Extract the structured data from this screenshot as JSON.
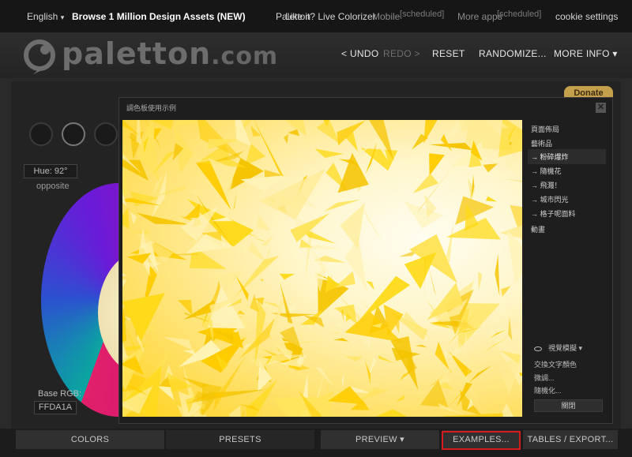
{
  "topbar": {
    "language": "English",
    "language_arrow": "▾",
    "promo": "Browse 1 Million Design Assets (NEW)",
    "paletton_label": "Paletton",
    "like_label": "Like it? Live Colorizer",
    "mobile_label": "Mobile",
    "mobile_status": "[scheduled]",
    "more_apps_label": "More apps",
    "more_apps_status": "[scheduled]",
    "cookie_label": "cookie settings"
  },
  "header": {
    "logo_main": "paletton",
    "logo_suffix": ".com",
    "undo_label": "< UNDO",
    "redo_label": "REDO >",
    "reset_label": "RESET",
    "randomize_label": "RANDOMIZE...",
    "more_info_label": "MORE INFO ▾"
  },
  "side_controls": {
    "donate_label": "Donate",
    "hue_label": "Hue: 92°",
    "scheme_label": "opposite",
    "base_rgb_label": "Base RGB:",
    "base_rgb_value": "FFDA1A"
  },
  "modal": {
    "title": "調色板使用示例",
    "close_label": "✕",
    "menu": [
      {
        "label": "頁面佈局"
      },
      {
        "label": "藝術品"
      },
      {
        "label": "→ 粉碎爆炸"
      },
      {
        "label": "→ 隨機花"
      },
      {
        "label": "→ 飛濺！"
      },
      {
        "label": "→ 城市閃光"
      },
      {
        "label": "→ 格子呢面料"
      },
      {
        "label": "動畫"
      }
    ],
    "vision_label": "視覺模擬 ▾",
    "option_1": "交換文字顏色",
    "option_2": "微調...",
    "option_3": "隨機化...",
    "close_button_label": "關閉"
  },
  "bottom_tabs": {
    "colors_label": "COLORS",
    "presets_label": "PRESETS",
    "preview_label": "PREVIEW ▾",
    "examples_label": "EXAMPLES...",
    "tables_label": "TABLES / EXPORT..."
  },
  "colors": {
    "palette": [
      "#FFDA1A",
      "#FFE45C",
      "#FFCC00",
      "#FFEC94",
      "#F5C400",
      "#FFF3B8"
    ],
    "highlight": "#D41C1C",
    "donate": "#C5A04C"
  }
}
